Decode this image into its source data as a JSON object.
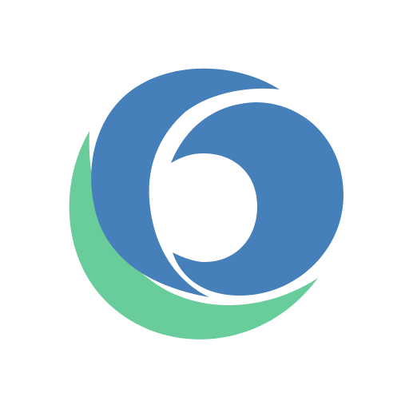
{
  "colors": {
    "background": "#ffffff",
    "outer_blue": "#4680bb",
    "inner_blue": "#4680bb",
    "green_crescent": "#69cc9b",
    "gap": "#ffffff"
  },
  "icon": "circular-swirl-logo-icon"
}
